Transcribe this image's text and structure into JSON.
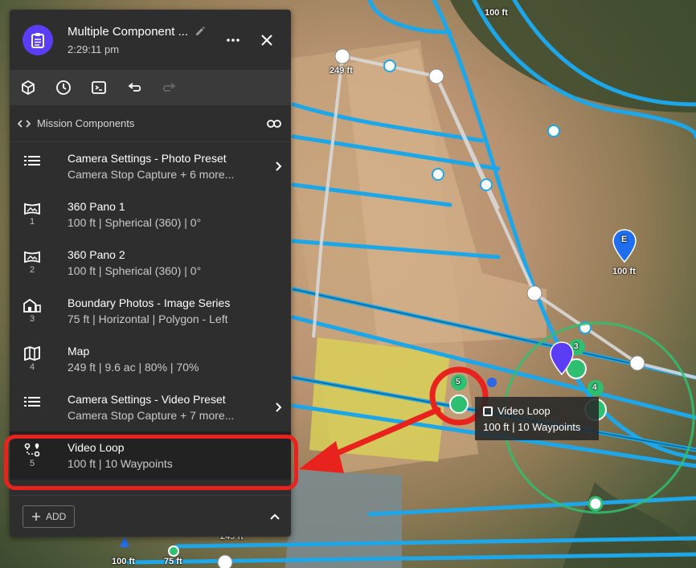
{
  "panel": {
    "title": "Multiple Component ...",
    "time": "2:29:11 pm",
    "section_title": "Mission Components",
    "add_label": "ADD",
    "items": [
      {
        "name": "Camera Settings - Photo Preset",
        "sub": "Camera Stop Capture + 6 more...",
        "num": "",
        "icon": "list-icon",
        "chevron": true
      },
      {
        "name": "360 Pano 1",
        "sub": "100 ft | Spherical (360) | 0°",
        "num": "1",
        "icon": "panorama-icon",
        "chevron": false
      },
      {
        "name": "360 Pano 2",
        "sub": "100 ft | Spherical (360) | 0°",
        "num": "2",
        "icon": "panorama-icon",
        "chevron": false
      },
      {
        "name": "Boundary Photos - Image Series",
        "sub": "75 ft | Horizontal | Polygon - Left",
        "num": "3",
        "icon": "building-icon",
        "chevron": false
      },
      {
        "name": "Map",
        "sub": "249 ft | 9.6 ac | 80% | 70%",
        "num": "4",
        "icon": "map-icon",
        "chevron": false
      },
      {
        "name": "Camera Settings - Video Preset",
        "sub": "Camera Stop Capture + 7 more...",
        "num": "",
        "icon": "list-icon",
        "chevron": true
      },
      {
        "name": "Video Loop",
        "sub": "100 ft | 10 Waypoints",
        "num": "5",
        "icon": "route-icon",
        "chevron": false
      }
    ]
  },
  "map": {
    "labels": {
      "top_right": "100 ft",
      "top_left": "249 ft",
      "marker_e": "100 ft",
      "bottom_left": "100 ft",
      "bottom_mid": "75 ft",
      "bottom_cut": "249 ft"
    },
    "badges": {
      "b5": "5",
      "b3": "3",
      "b4": "4",
      "e": "E"
    },
    "tooltip": {
      "title": "Video Loop",
      "sub": "100 ft | 10 Waypoints"
    }
  },
  "colors": {
    "accent": "#5b3df5",
    "flight_line": "#1ea7e8",
    "annotation": "#e8221c",
    "waypoint_green": "#2fbf71"
  }
}
